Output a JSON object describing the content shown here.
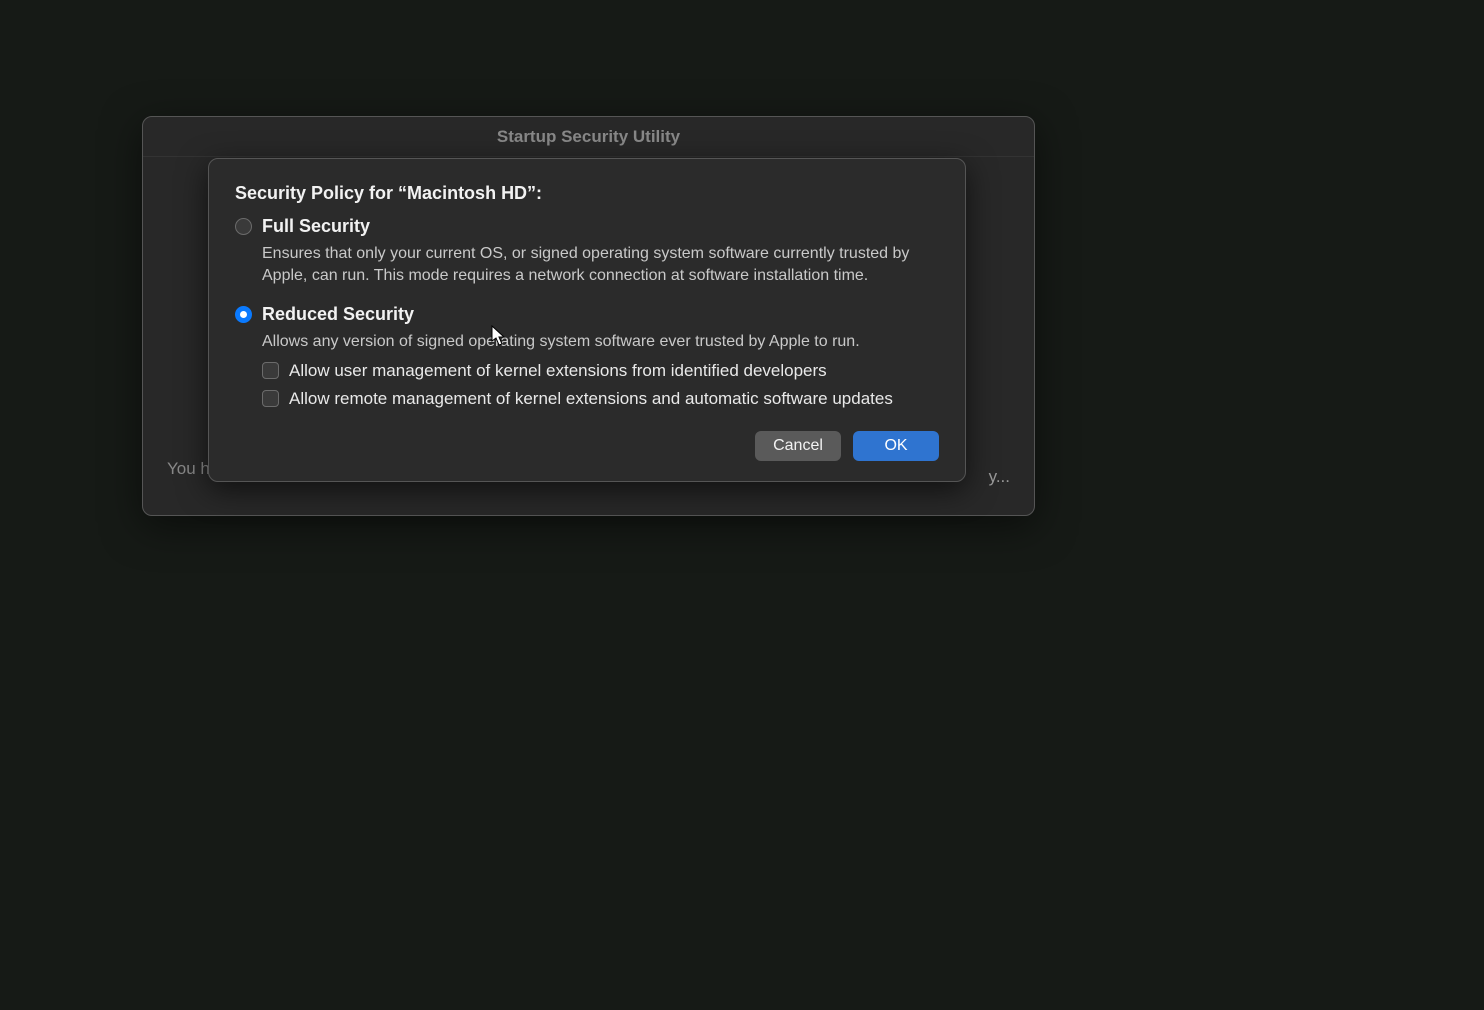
{
  "window": {
    "title": "Startup Security Utility",
    "body_text_partial": "You h",
    "body_button_partial": "y..."
  },
  "sheet": {
    "title": "Security Policy for “Macintosh HD”:",
    "options": [
      {
        "label": "Full Security",
        "description": "Ensures that only your current OS, or signed operating system software currently trusted by Apple, can run. This mode requires a network connection at software installation time.",
        "selected": false
      },
      {
        "label": "Reduced Security",
        "description": "Allows any version of signed operating system software ever trusted by Apple to run.",
        "selected": true,
        "checkboxes": [
          {
            "label": "Allow user management of kernel extensions from identified developers",
            "checked": false
          },
          {
            "label": "Allow remote management of kernel extensions and automatic software updates",
            "checked": false
          }
        ]
      }
    ],
    "buttons": {
      "cancel": "Cancel",
      "ok": "OK"
    }
  }
}
